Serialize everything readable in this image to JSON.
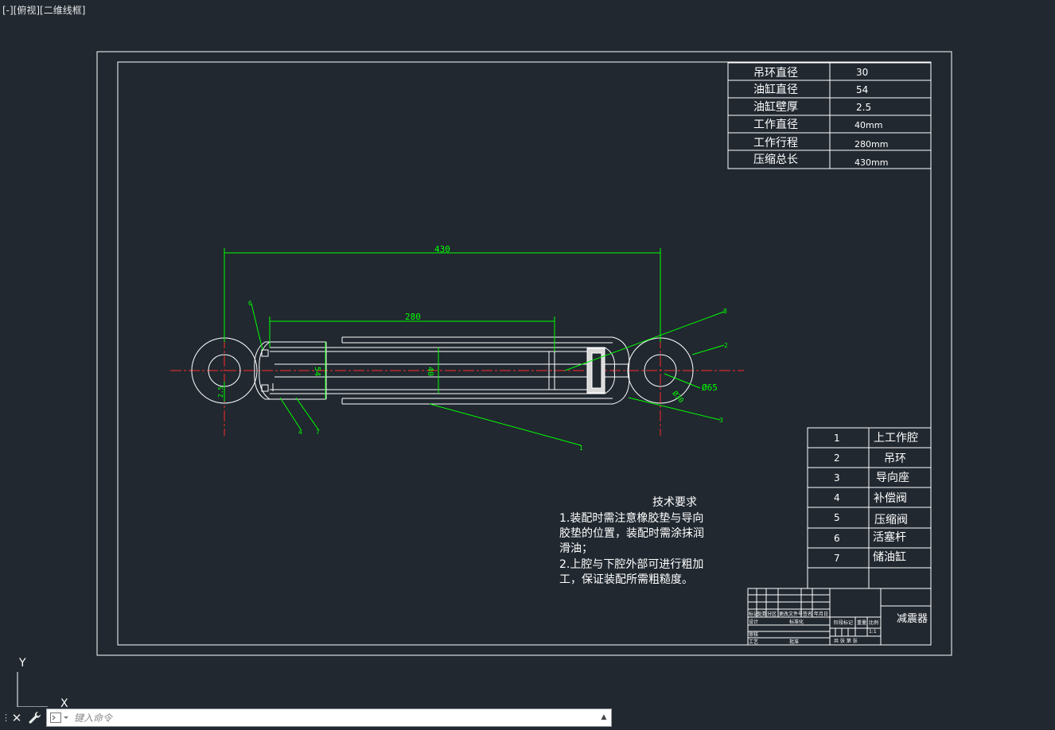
{
  "viewport": {
    "label": "[-][俯视][二维线框]"
  },
  "ucs": {
    "y_label": "Y",
    "x_label": "X"
  },
  "params": [
    {
      "name": "吊环直径",
      "value": "30"
    },
    {
      "name": "油缸直径",
      "value": "54"
    },
    {
      "name": "油缸壁厚",
      "value": "2.5"
    },
    {
      "name": "工作直径",
      "value": "40mm"
    },
    {
      "name": "工作行程",
      "value": "280mm"
    },
    {
      "name": "压缩总长",
      "value": "430mm"
    }
  ],
  "dims": {
    "overall": "430",
    "stroke": "280",
    "cyl": "54",
    "work": "40",
    "eye_outer": "Ø65",
    "eye_inner": "Ø30",
    "wall": "2.5"
  },
  "callouts": {
    "c1": "1",
    "c2": "2",
    "c3": "3",
    "c4": "4",
    "c7": "7",
    "c8": "8",
    "c6": "6"
  },
  "parts": [
    {
      "no": "1",
      "name": "上工作腔"
    },
    {
      "no": "2",
      "name": "吊环"
    },
    {
      "no": "3",
      "name": "导向座"
    },
    {
      "no": "4",
      "name": "补偿阀"
    },
    {
      "no": "5",
      "name": "压缩阀"
    },
    {
      "no": "6",
      "name": "活塞杆"
    },
    {
      "no": "7",
      "name": "储油缸"
    }
  ],
  "notes": {
    "title": "技术要求",
    "lines": [
      "1.装配时需注意橡胶垫与导向",
      "胶垫的位置，装配时需涂抹润",
      "滑油；",
      "2.上腔与下腔外部可进行粗加",
      "工，保证装配所需粗糙度。"
    ]
  },
  "titleblock": {
    "drawing_name": "减震器",
    "h1": "标记",
    "h2": "处数",
    "h3": "分区",
    "h4": "更改文件号",
    "h5": "签名",
    "h6": "年月日",
    "r_design": "设计",
    "r_std": "标准化",
    "r_review": "审核",
    "r_craft": "工艺",
    "r_approve": "批准",
    "stage": "阶段标记",
    "weight": "重量",
    "scale": "比例",
    "scale_val": "1:1",
    "sheets": "共 张 第 张"
  },
  "command": {
    "placeholder": "键入命令"
  },
  "icons": {
    "close": "close-icon",
    "wrench": "wrench-icon",
    "prompt": "command-prompt-icon",
    "history": "chevron-up-icon"
  }
}
